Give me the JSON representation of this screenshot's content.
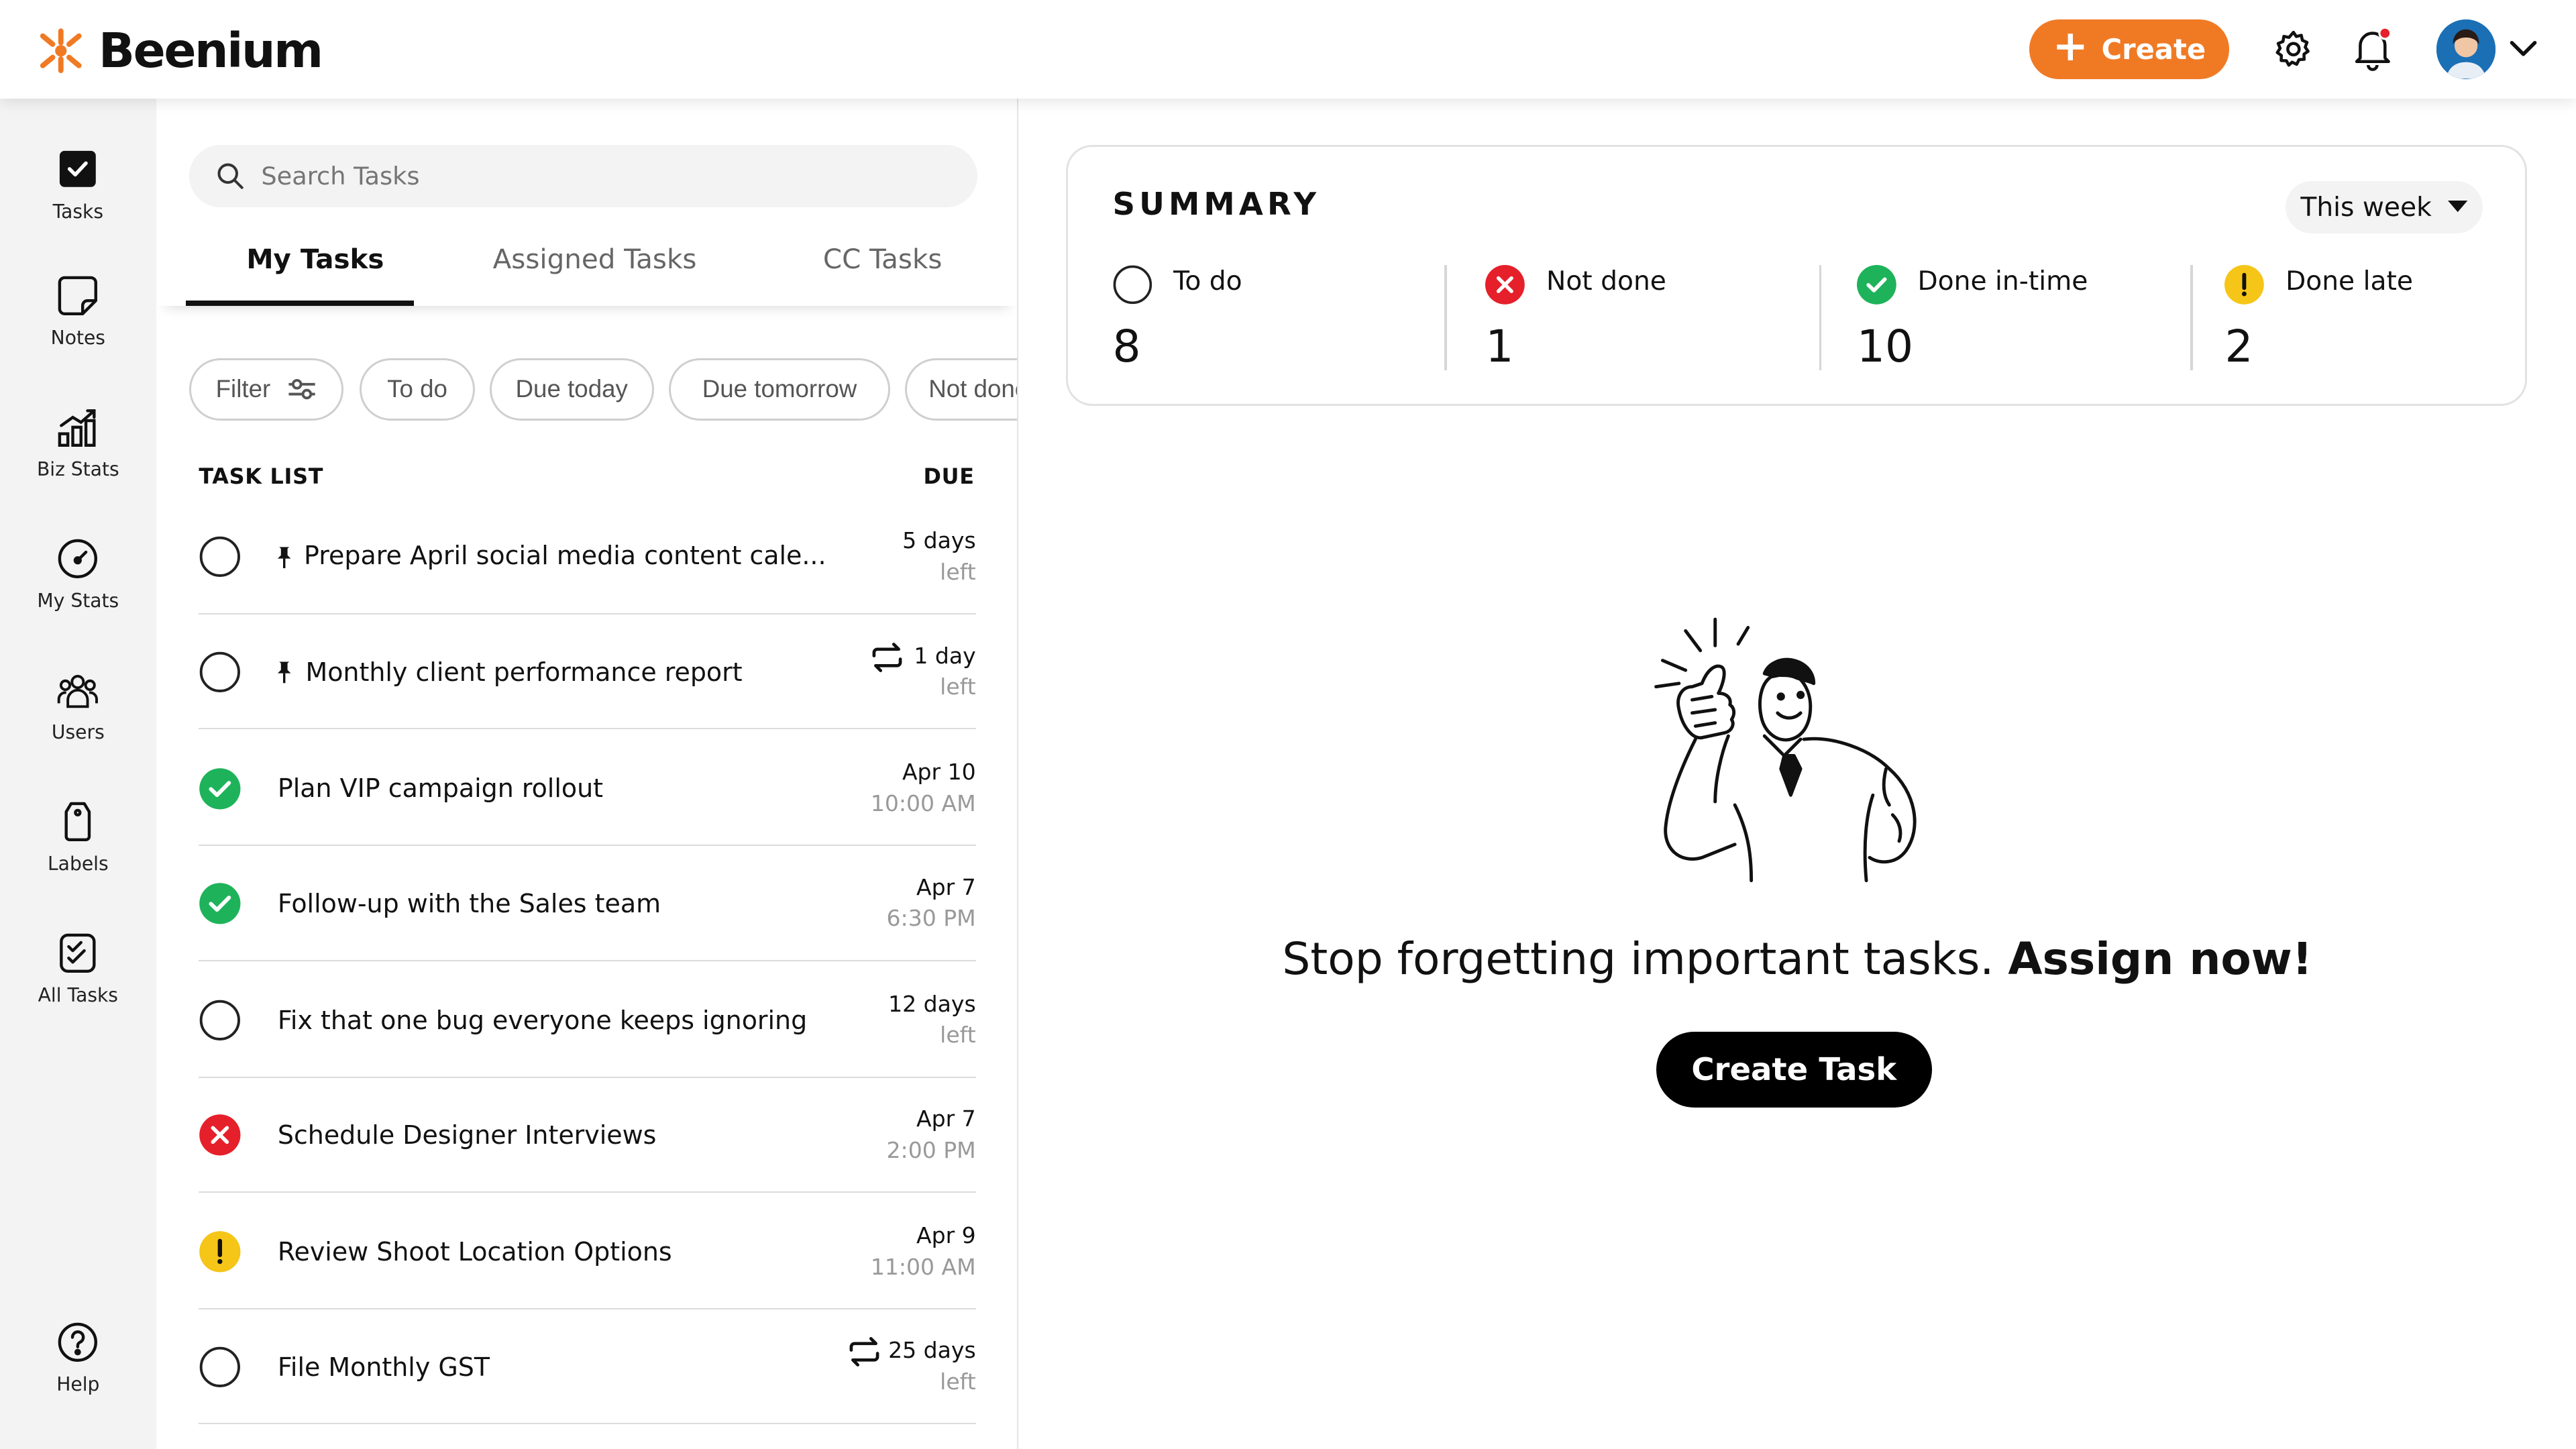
{
  "app": {
    "name": "Beenium"
  },
  "header": {
    "create_label": "Create"
  },
  "sidebar": {
    "items": [
      {
        "label": "Tasks"
      },
      {
        "label": "Notes"
      },
      {
        "label": "Biz Stats"
      },
      {
        "label": "My Stats"
      },
      {
        "label": "Users"
      },
      {
        "label": "Labels"
      },
      {
        "label": "All Tasks"
      },
      {
        "label": "Help"
      }
    ]
  },
  "tasks_panel": {
    "search_placeholder": "Search Tasks",
    "tabs": [
      {
        "label": "My Tasks",
        "active": true
      },
      {
        "label": "Assigned Tasks"
      },
      {
        "label": "CC Tasks"
      }
    ],
    "filters": [
      "Filter",
      "To do",
      "Due today",
      "Due tomorrow",
      "Not done"
    ],
    "list_header": "TASK LIST",
    "due_header": "DUE",
    "tasks": [
      {
        "title": "Prepare April social media content cale...",
        "status": "todo",
        "pinned": true,
        "recurring": false,
        "due_line1": "5 days",
        "due_line2": "left"
      },
      {
        "title": "Monthly client performance report",
        "status": "todo",
        "pinned": true,
        "recurring": true,
        "due_line1": "1 day",
        "due_line2": "left"
      },
      {
        "title": "Plan VIP campaign rollout",
        "status": "done",
        "pinned": false,
        "recurring": false,
        "due_line1": "Apr 10",
        "due_line2": "10:00 AM"
      },
      {
        "title": "Follow-up with the Sales team",
        "status": "done",
        "pinned": false,
        "recurring": false,
        "due_line1": "Apr 7",
        "due_line2": "6:30 PM"
      },
      {
        "title": "Fix that one bug everyone keeps ignoring",
        "status": "todo",
        "pinned": false,
        "recurring": false,
        "due_line1": "12 days",
        "due_line2": "left"
      },
      {
        "title": "Schedule Designer Interviews",
        "status": "not_done",
        "pinned": false,
        "recurring": false,
        "due_line1": "Apr 7",
        "due_line2": "2:00 PM"
      },
      {
        "title": "Review Shoot Location Options",
        "status": "late",
        "pinned": false,
        "recurring": false,
        "due_line1": "Apr 9",
        "due_line2": "11:00 AM"
      },
      {
        "title": "File Monthly GST",
        "status": "todo",
        "pinned": false,
        "recurring": true,
        "due_line1": "25 days",
        "due_line2": "left"
      }
    ]
  },
  "summary": {
    "title": "SUMMARY",
    "period": "This week",
    "stats": [
      {
        "label": "To do",
        "value": "8"
      },
      {
        "label": "Not done",
        "value": "1"
      },
      {
        "label": "Done in-time",
        "value": "10"
      },
      {
        "label": "Done late",
        "value": "2"
      }
    ]
  },
  "empty_state": {
    "message": "Stop forgetting important tasks.",
    "message_bold": "Assign now!",
    "button_label": "Create Task"
  },
  "colors": {
    "accent": "#f07a24",
    "done": "#1eb35a",
    "not_done": "#e5202a",
    "late": "#f5c518"
  }
}
